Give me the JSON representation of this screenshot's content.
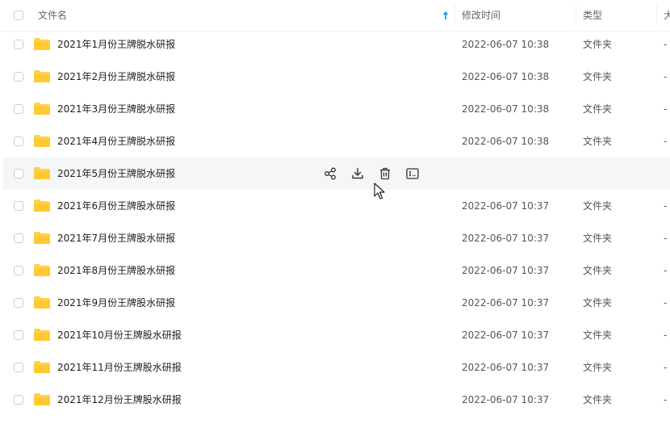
{
  "header": {
    "name_label": "文件名",
    "time_label": "修改时间",
    "type_label": "类型",
    "size_label": "大"
  },
  "rows": [
    {
      "name": "2021年1月份王牌脱水研报",
      "time": "2022-06-07 10:38",
      "type": "文件夹",
      "size": "-"
    },
    {
      "name": "2021年2月份王牌脱水研报",
      "time": "2022-06-07 10:38",
      "type": "文件夹",
      "size": "-"
    },
    {
      "name": "2021年3月份王牌脱水研报",
      "time": "2022-06-07 10:38",
      "type": "文件夹",
      "size": "-"
    },
    {
      "name": "2021年4月份王牌脱水研报",
      "time": "2022-06-07 10:38",
      "type": "文件夹",
      "size": "-"
    },
    {
      "name": "2021年5月份王牌脱水研报",
      "time": "",
      "type": "",
      "size": ""
    },
    {
      "name": "2021年6月份王牌股水研报",
      "time": "2022-06-07 10:37",
      "type": "文件夹",
      "size": "-"
    },
    {
      "name": "2021年7月份王牌股水研报",
      "time": "2022-06-07 10:37",
      "type": "文件夹",
      "size": "-"
    },
    {
      "name": "2021年8月份王牌股水研报",
      "time": "2022-06-07 10:37",
      "type": "文件夹",
      "size": "-"
    },
    {
      "name": "2021年9月份王牌股水研报",
      "time": "2022-06-07 10:37",
      "type": "文件夹",
      "size": "-"
    },
    {
      "name": "2021年10月份王牌股水研报",
      "time": "2022-06-07 10:37",
      "type": "文件夹",
      "size": "-"
    },
    {
      "name": "2021年11月份王牌股水研报",
      "time": "2022-06-07 10:37",
      "type": "文件夹",
      "size": "-"
    },
    {
      "name": "2021年12月份王牌股水研报",
      "time": "2022-06-07 10:37",
      "type": "文件夹",
      "size": "-"
    }
  ],
  "hover_actions": [
    "share-icon",
    "download-icon",
    "delete-icon",
    "rename-icon"
  ],
  "colors": {
    "folder": "#ffd24d",
    "accent": "#06a7ff",
    "hover_bg": "#f5f6f8"
  }
}
